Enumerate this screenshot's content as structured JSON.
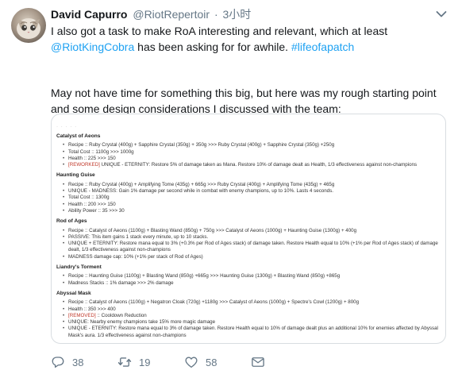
{
  "author": {
    "name": "David Capurro",
    "handle": "@RiotRepertoir",
    "separator": "·",
    "time": "3小时"
  },
  "tweet": {
    "line1": "I also got a task to make RoA interesting and relevant, which at least",
    "mention": "@RiotKingCobra",
    "line2_rest": " has been asking for for awhile. ",
    "hashtag": "#lifeofapatch",
    "para2": "May not have time for something this big, but here was my rough starting point and some design considerations I discussed with the team:"
  },
  "embed": {
    "dots": "· · · · ·",
    "sections": [
      {
        "title": "Catalyst of Aeons",
        "items": [
          {
            "text": "Recipe :: Ruby Crystal (400g) + Sapphire Crystal (350g) + 350g >>> Ruby Crystal (400g) + Sapphire Crystal (350g) +250g"
          },
          {
            "text": "Total Cost :: 1100g >>> 1000g"
          },
          {
            "text": "Health :: 225 >>> 150"
          },
          {
            "prefix": "[REWORKED]",
            "text": " UNIQUE - ETERNITY: Restore 5% of damage taken as Mana. Restore 10% of damage dealt as Health, 1/3 effectiveness against non-champions"
          }
        ]
      },
      {
        "title": "Haunting Guise",
        "items": [
          {
            "text": "Recipe :: Ruby Crystal (400g) + Amplifying Tome (435g) + 665g >>> Ruby Crystal (400g) + Amplifying Tome (435g) + 465g"
          },
          {
            "text": "UNIQUE - MADNESS: Gain 1% damage per second while in combat with enemy champions, up to 10%. Lasts 4 seconds."
          },
          {
            "text": "Total Cost :: 1300g"
          },
          {
            "text": "Health :: 200 >>> 150"
          },
          {
            "text": "Ability Power :: 35 >>> 30"
          }
        ]
      },
      {
        "title": "Rod of Ages",
        "items": [
          {
            "text": "Recipe :: Catalyst of Aeons (1100g) + Blasting Wand (850g) + 750g >>> Catalyst of Aeons (1000g) + Haunting Guise (1300g) + 400g"
          },
          {
            "text": "PASSIVE: This item gains 1 stack every minute, up to 10 stacks."
          },
          {
            "text": "UNIQUE + ETERNITY: Restore mana equal to 3% (+0.3% per Rod of Ages stack) of damage taken. Restore Health equal to 10% (+1% per Rod of Ages stack) of damage dealt, 1/3 effectiveness against non-champions"
          },
          {
            "text": "MADNESS damage cap: 10% (+1% per stack of Rod of Ages)"
          }
        ]
      },
      {
        "title": "Liandry's Torment",
        "items": [
          {
            "text": "Recipe :: Haunting Guise (1100g) + Blasting Wand (850g) +665g >>> Haunting Guise (1300g) + Blasting Wand (850g) +865g"
          },
          {
            "text": "Madness Stacks :: 1% damage >>> 2% damage"
          }
        ]
      },
      {
        "title": "Abyssal Mask",
        "items": [
          {
            "text": "Recipe :: Catalyst of Aeons (1100g) + Negatron Cloak (720g) +1180g >>> Catalyst of Aeons (1000g) + Spectre's Cowl (1200g) + 800g"
          },
          {
            "text": "Health :: 350 >>> 400"
          },
          {
            "prefix": "[REMOVED]",
            "text": " :: Cooldown Reduction"
          },
          {
            "text": "UNIQUE: Nearby enemy champions take 15% more magic damage"
          },
          {
            "text": "UNIQUE - ETERNITY: Restore mana equal to 3% of damage taken. Restore Health equal to 10% of damage dealt plus an additional 10% for enemies affected by Abyssal Mask's aura. 1/3 effectiveness against non-champions"
          }
        ]
      }
    ]
  },
  "actions": {
    "reply_count": "38",
    "retweet_count": "19",
    "like_count": "58"
  },
  "colors": {
    "link": "#1da1f2",
    "muted": "#657786",
    "text": "#14171a",
    "reworked": "#c0392b"
  },
  "icons": [
    "reply-icon",
    "retweet-icon",
    "heart-icon",
    "mail-icon",
    "chevron-down-icon"
  ]
}
